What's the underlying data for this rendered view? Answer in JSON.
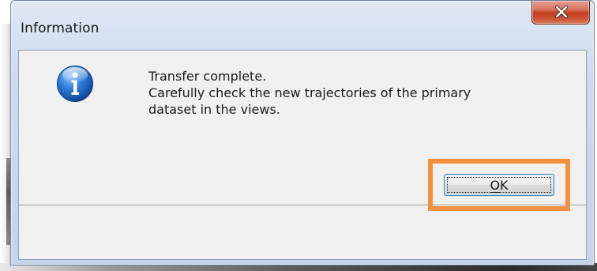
{
  "window": {
    "title": "Information"
  },
  "icons": {
    "close": "close-icon",
    "info": "information-icon"
  },
  "message": {
    "lines": [
      "Transfer complete.",
      "Carefully check the new trajectories of the primary",
      "dataset in the views."
    ]
  },
  "buttons": {
    "ok_label": "OK"
  },
  "colors": {
    "highlight": "#f2913d",
    "close_button": "#c4401f",
    "info_icon": "#1a63c4"
  }
}
